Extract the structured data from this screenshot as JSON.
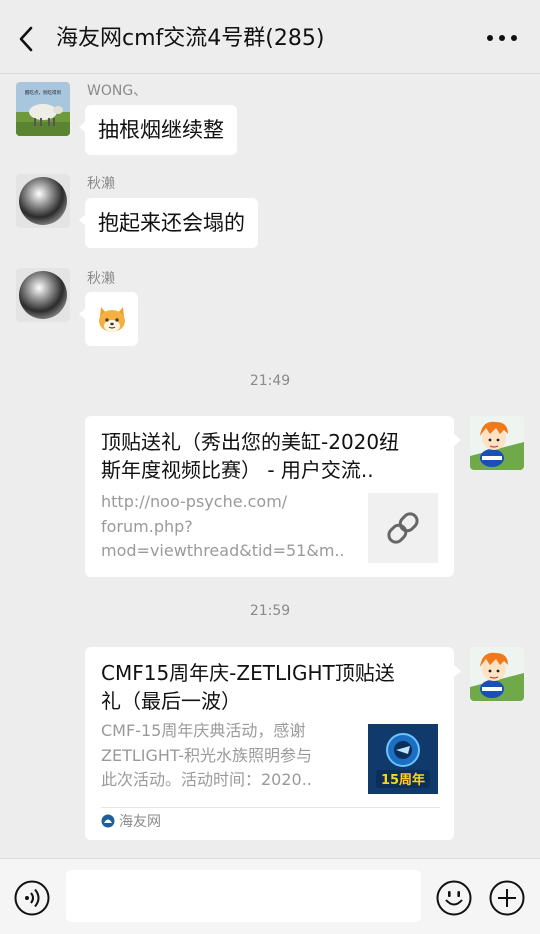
{
  "header": {
    "title": "海友网cmf交流4号群(285)",
    "back_icon": "chevron-left-icon",
    "more_icon": "more-dots-icon"
  },
  "messages": [
    {
      "sender": "WONG、",
      "text": "抽根烟继续整",
      "avatar": "sheep-photo-avatar",
      "avatar_caption": "醒吃点，别吃得到"
    },
    {
      "sender": "秋濑",
      "text": "抱起来还会塌的",
      "avatar": "metal-sphere-avatar"
    },
    {
      "sender": "秋濑",
      "sticker": "shiba-dog-emoji",
      "avatar": "metal-sphere-avatar"
    }
  ],
  "timestamps": [
    "21:49",
    "21:59"
  ],
  "cards": [
    {
      "title_lines": [
        "顶贴送礼（秀出您的美缸-2020纽",
        "斯年度视频比赛） - 用户交流.."
      ],
      "desc_lines": [
        "http://noo-psyche.com/",
        "forum.php?",
        "mod=viewthread&tid=51&m.."
      ],
      "thumb": "link-icon",
      "avatar": "cartoon-boy-avatar"
    },
    {
      "title_lines": [
        "CMF15周年庆-ZETLIGHT顶贴送",
        "礼（最后一波）"
      ],
      "desc_lines": [
        "CMF-15周年庆典活动，感谢",
        "ZETLIGHT-积光水族照明参与",
        "此次活动。活动时间：2020.."
      ],
      "thumb": "cmf-15-anniversary-logo",
      "thumb_text": "15周年",
      "source": "海友网",
      "source_icon": "haiyou-logo-icon",
      "avatar": "cartoon-boy-avatar"
    }
  ],
  "input_bar": {
    "voice_icon": "voice-icon",
    "emoji_icon": "emoji-icon",
    "plus_icon": "plus-icon"
  },
  "colors": {
    "background": "#ededed",
    "bubble": "#ffffff",
    "meta_text": "#8a8a8a"
  }
}
